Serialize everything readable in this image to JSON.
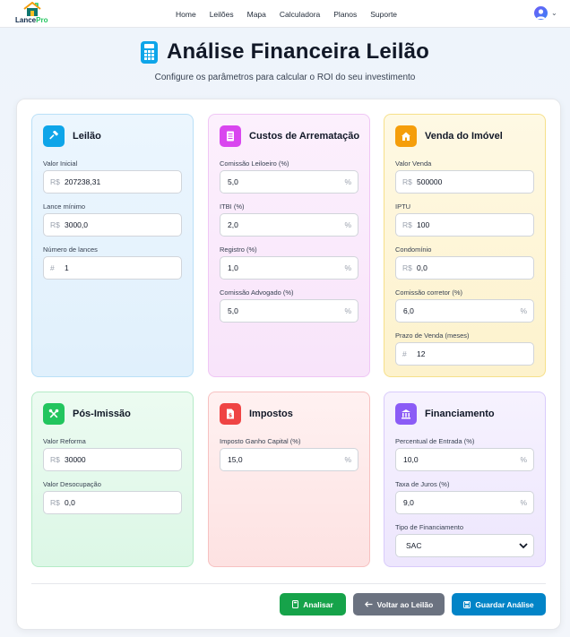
{
  "brand": {
    "name_main": "Lance",
    "name_accent": "Pro"
  },
  "nav": {
    "links": [
      "Home",
      "Leilões",
      "Mapa",
      "Calculadora",
      "Planos",
      "Suporte"
    ]
  },
  "header": {
    "title": "Análise Financeira Leilão",
    "subtitle": "Configure os parâmetros para calcular o ROI do seu investimento"
  },
  "sections": {
    "leilao": {
      "title": "Leilão",
      "icon": "gavel-icon",
      "fields": [
        {
          "label": "Valor Inicial",
          "prefix": "R$",
          "value": "207238,31"
        },
        {
          "label": "Lance mínimo",
          "prefix": "R$",
          "value": "3000,0"
        },
        {
          "label": "Número de lances",
          "prefix": "#",
          "value": "1"
        }
      ]
    },
    "custos": {
      "title": "Custos de Arrematação",
      "icon": "receipt-icon",
      "fields": [
        {
          "label": "Comissão Leiloeiro (%)",
          "value": "5,0",
          "suffix": "%"
        },
        {
          "label": "ITBI (%)",
          "value": "2,0",
          "suffix": "%"
        },
        {
          "label": "Registro (%)",
          "value": "1,0",
          "suffix": "%"
        },
        {
          "label": "Comissão Advogado (%)",
          "value": "5,0",
          "suffix": "%"
        }
      ]
    },
    "venda": {
      "title": "Venda do Imóvel",
      "icon": "house-icon",
      "fields": [
        {
          "label": "Valor Venda",
          "prefix": "R$",
          "value": "500000"
        },
        {
          "label": "IPTU",
          "prefix": "R$",
          "value": "100"
        },
        {
          "label": "Condomínio",
          "prefix": "R$",
          "value": "0,0"
        },
        {
          "label": "Comissão corretor (%)",
          "value": "6,0",
          "suffix": "%"
        },
        {
          "label": "Prazo de Venda (meses)",
          "prefix": "#",
          "value": "12"
        }
      ]
    },
    "pos": {
      "title": "Pós-Imissão",
      "icon": "tools-icon",
      "fields": [
        {
          "label": "Valor Reforma",
          "prefix": "R$",
          "value": "30000"
        },
        {
          "label": "Valor Desocupação",
          "prefix": "R$",
          "value": "0,0"
        }
      ]
    },
    "impostos": {
      "title": "Impostos",
      "icon": "tax-document-icon",
      "fields": [
        {
          "label": "Imposto Ganho Capital (%)",
          "value": "15,0",
          "suffix": "%"
        }
      ]
    },
    "financiamento": {
      "title": "Financiamento",
      "icon": "bank-icon",
      "fields": [
        {
          "label": "Percentual de Entrada (%)",
          "value": "10,0",
          "suffix": "%"
        },
        {
          "label": "Taxa de Juros (%)",
          "value": "9,0",
          "suffix": "%"
        }
      ],
      "select": {
        "label": "Tipo de Financiamento",
        "value": "SAC"
      }
    }
  },
  "actions": {
    "analisar": "Analisar",
    "voltar": "Voltar ao Leilão",
    "guardar": "Guardar Análise"
  },
  "colors": {
    "leilao_icon": "#0ea5e9",
    "custos_icon": "#d946ef",
    "venda_icon": "#f59e0b",
    "pos_icon": "#22c55e",
    "impostos_icon": "#ef4444",
    "financiamento_icon": "#8b5cf6",
    "btn_analisar": "#16a34a",
    "btn_voltar": "#6b7280",
    "btn_guardar": "#0284c7"
  }
}
